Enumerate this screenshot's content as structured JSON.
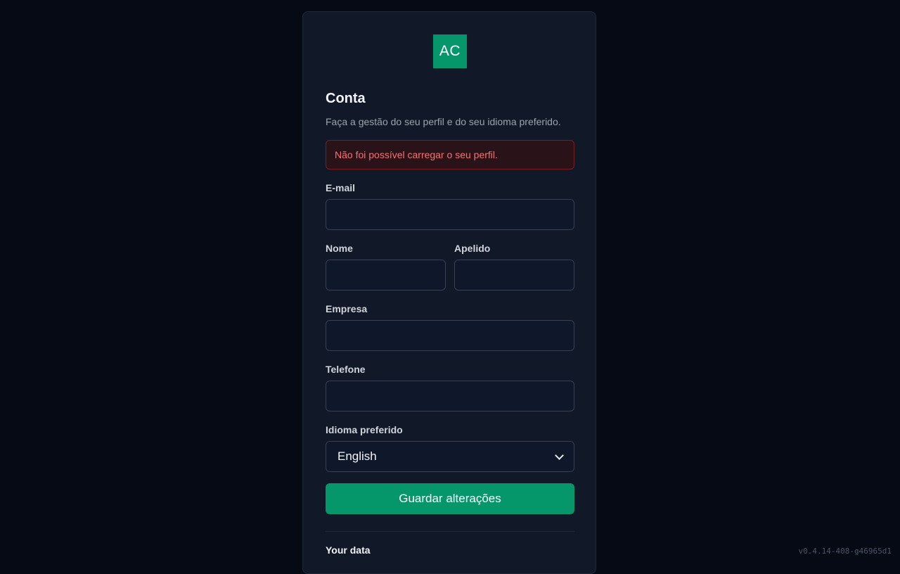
{
  "logo": {
    "text": "AC",
    "color": "#059669"
  },
  "page": {
    "title": "Conta",
    "subtitle": "Faça a gestão do seu perfil e do seu idioma preferido."
  },
  "error": {
    "message": "Não foi possível carregar o seu perfil."
  },
  "form": {
    "email": {
      "label": "E-mail",
      "value": ""
    },
    "first_name": {
      "label": "Nome",
      "value": ""
    },
    "last_name": {
      "label": "Apelido",
      "value": ""
    },
    "company": {
      "label": "Empresa",
      "value": ""
    },
    "phone": {
      "label": "Telefone",
      "value": ""
    },
    "language": {
      "label": "Idioma preferido",
      "selected": "English"
    },
    "save_label": "Guardar alterações"
  },
  "data_section": {
    "title": "Your data"
  },
  "footer": {
    "version": "v0.4.14-408-g46965d1"
  },
  "colors": {
    "background": "#050a14",
    "card": "#111827",
    "accent": "#059669",
    "error_text": "#f87171"
  }
}
